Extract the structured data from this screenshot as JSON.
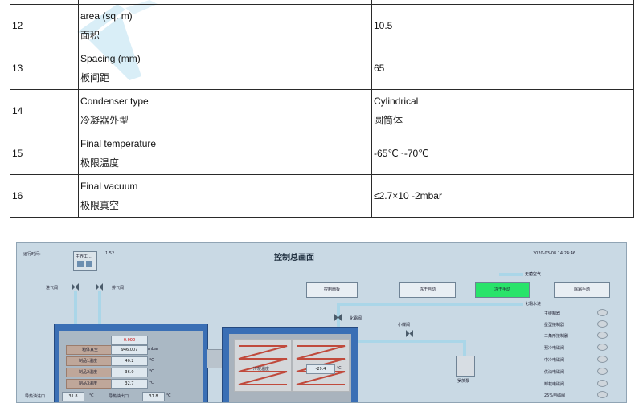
{
  "spec_rows": [
    {
      "index": "12",
      "name_en": "area (sq. m)",
      "name_cn": "面积",
      "value": "10.5"
    },
    {
      "index": "13",
      "name_en": "Spacing (mm)",
      "name_cn": "板间距",
      "value": "65"
    },
    {
      "index": "14",
      "name_en": "Condenser type",
      "name_cn": "冷凝器外型",
      "value": "Cylindrical",
      "value_cn": "圆筒体"
    },
    {
      "index": "15",
      "name_en": "Final temperature",
      "name_cn": "极限温度",
      "value": "-65℃~-70℃"
    },
    {
      "index": "16",
      "name_en": "Final vacuum",
      "name_cn": "极限真空",
      "value": "≤2.7×10 -2mbar"
    }
  ],
  "hmi": {
    "runtime_label": "运行时间:",
    "runtime_value": "1.52",
    "title": "控制总画面",
    "datetime": "2020-03-08 14:24:46",
    "panel_label": "主界工...",
    "intake_valve": "进气阀",
    "exhaust_valve": "排气阀",
    "buttons": [
      "控制面板",
      "冻干自动",
      "冻干手动",
      "除霜手动"
    ],
    "active_button_index": 2,
    "sterile_air": "无菌空气",
    "defrost_water": "化霜水进",
    "defrost_valve": "化霜阀",
    "small_butterfly": "小蝶阀",
    "pump_label": "罗茨泵",
    "status_items": [
      "主继制器",
      "星型接制器",
      "三角形接制器",
      "预冷电磁阀",
      "中冷电磁阀",
      "供油电磁阀",
      "卸载电磁阀",
      "25%电磁阀"
    ],
    "chamber": {
      "setpoint": "0.000",
      "rows": [
        {
          "label": "箱体真空",
          "value": "946.007",
          "unit": "mbar"
        },
        {
          "label": "制品1温度",
          "value": "40.2",
          "unit": "℃"
        },
        {
          "label": "制品2温度",
          "value": "36.0",
          "unit": "℃"
        },
        {
          "label": "制品3温度",
          "value": "32.7",
          "unit": "℃"
        }
      ]
    },
    "condenser": {
      "label": "冷凝温度",
      "value": "-29.4",
      "unit": "℃"
    },
    "heat_in_label": "导热油进口",
    "heat_in_value": "31.8",
    "heat_out_label": "导热油出口",
    "heat_out_value": "37.8",
    "temp_unit": "℃"
  },
  "colors": {
    "active_green": "#29e36a",
    "chamber_blue": "#3a6fb5",
    "hmi_bg": "#c9d9e4"
  }
}
